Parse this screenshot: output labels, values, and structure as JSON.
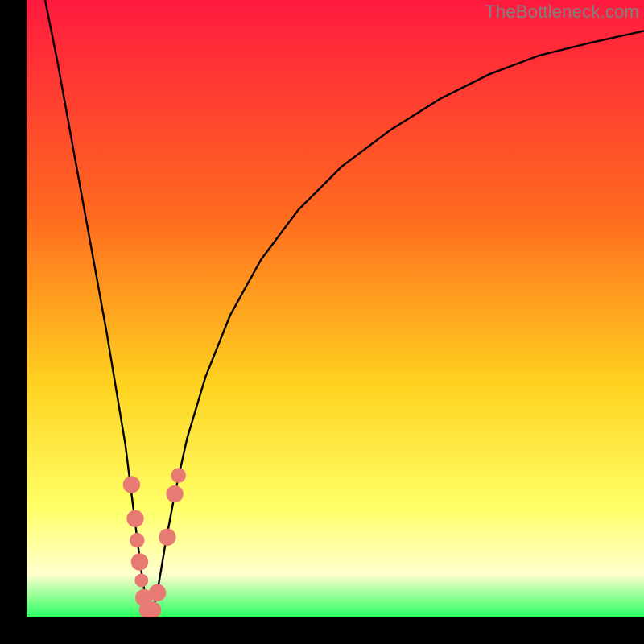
{
  "watermark": "TheBottleneck.com",
  "colors": {
    "gradient_top": "#ff1a3f",
    "gradient_mid1": "#ff6a1f",
    "gradient_mid2": "#ffd21f",
    "gradient_low": "#ffff66",
    "gradient_pale": "#ffffcc",
    "gradient_bottom": "#2bff62",
    "curve": "#000000",
    "marker_fill": "#e77b74",
    "marker_stroke": "#c55a54"
  },
  "chart_data": {
    "type": "line",
    "title": "",
    "xlabel": "",
    "ylabel": "",
    "xlim": [
      0,
      100
    ],
    "ylim": [
      0,
      100
    ],
    "series": [
      {
        "name": "bottleneck-curve",
        "x": [
          3,
          5,
          7,
          9,
          11,
          13,
          14.5,
          16,
          17,
          18,
          18.8,
          19.5,
          20,
          20.7,
          21.5,
          22.5,
          24,
          26,
          29,
          33,
          38,
          44,
          51,
          59,
          67,
          75,
          83,
          91,
          100
        ],
        "values": [
          100,
          90,
          79,
          68,
          57,
          46,
          37,
          28,
          20,
          12,
          6,
          2,
          0,
          2,
          6,
          12,
          20,
          29,
          39,
          49,
          58,
          66,
          73,
          79,
          84,
          88,
          91,
          93,
          95
        ]
      }
    ],
    "markers": [
      {
        "x": 17.0,
        "y": 21.5,
        "r": 1.4
      },
      {
        "x": 17.6,
        "y": 16.0,
        "r": 1.4
      },
      {
        "x": 17.9,
        "y": 12.5,
        "r": 1.2
      },
      {
        "x": 18.3,
        "y": 9.0,
        "r": 1.4
      },
      {
        "x": 18.6,
        "y": 6.0,
        "r": 1.1
      },
      {
        "x": 19.0,
        "y": 3.2,
        "r": 1.4
      },
      {
        "x": 19.6,
        "y": 1.2,
        "r": 1.4
      },
      {
        "x": 20.4,
        "y": 1.2,
        "r": 1.4
      },
      {
        "x": 21.2,
        "y": 4.0,
        "r": 1.4
      },
      {
        "x": 22.8,
        "y": 13.0,
        "r": 1.4
      },
      {
        "x": 24.0,
        "y": 20.0,
        "r": 1.4
      },
      {
        "x": 24.6,
        "y": 23.0,
        "r": 1.2
      }
    ]
  }
}
